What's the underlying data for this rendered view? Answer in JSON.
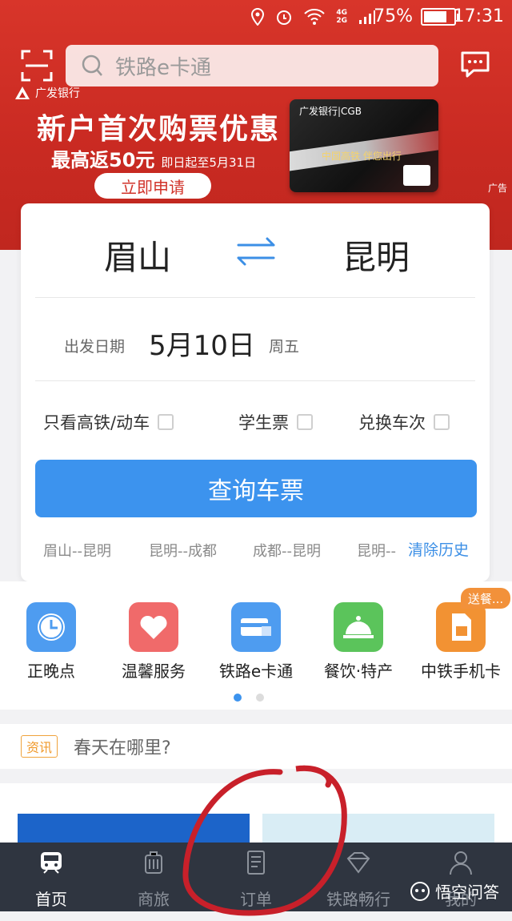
{
  "status_bar": {
    "net_label_top": "4G",
    "net_label_bottom": "2G",
    "battery": "75%",
    "time": "17:31"
  },
  "search": {
    "placeholder": "铁路e卡通"
  },
  "banner": {
    "bank_name": "广发银行",
    "title": "新户首次购票优惠",
    "subtitle_big": "最高返50元",
    "subtitle_small": "即日起至5月31日",
    "apply_label": "立即申请",
    "card_bank": "广发银行|CGB",
    "card_slogan": "中国高铁 伴您出行",
    "ad_tag": "广告"
  },
  "booking": {
    "from": "眉山",
    "to": "昆明",
    "date_label": "出发日期",
    "date_value": "5月10日",
    "weekday": "周五",
    "options": [
      "只看高铁/动车",
      "学生票",
      "兑换车次"
    ],
    "search_label": "查询车票",
    "history": [
      "眉山--昆明",
      "昆明--成都",
      "成都--昆明",
      "昆明--"
    ],
    "clear_history": "清除历史"
  },
  "quick_entries": [
    {
      "label": "正晚点",
      "icon": "clock-icon",
      "color": "#4e9cf0"
    },
    {
      "label": "温馨服务",
      "icon": "heart-icon",
      "color": "#f06a6a"
    },
    {
      "label": "铁路e卡通",
      "icon": "card-icon",
      "color": "#4e9cf0"
    },
    {
      "label": "餐饮·特产",
      "icon": "bell-icon",
      "color": "#5bc45b"
    },
    {
      "label": "中铁手机卡",
      "icon": "sim-icon",
      "color": "#f29233"
    }
  ],
  "promo_badge": "送餐...",
  "news": {
    "tag": "资讯",
    "text": "春天在哪里?"
  },
  "tabs": [
    {
      "label": "首页",
      "icon": "train-icon",
      "active": true
    },
    {
      "label": "商旅",
      "icon": "luggage-icon",
      "active": false
    },
    {
      "label": "订单",
      "icon": "order-icon",
      "active": false
    },
    {
      "label": "铁路畅行",
      "icon": "diamond-icon",
      "active": false
    },
    {
      "label": "我的",
      "icon": "user-icon",
      "active": false
    }
  ],
  "watermark": "悟空问答",
  "colors": {
    "brand_red": "#c92a22",
    "primary_blue": "#3c93ee",
    "tab_bg": "#2f3540"
  }
}
